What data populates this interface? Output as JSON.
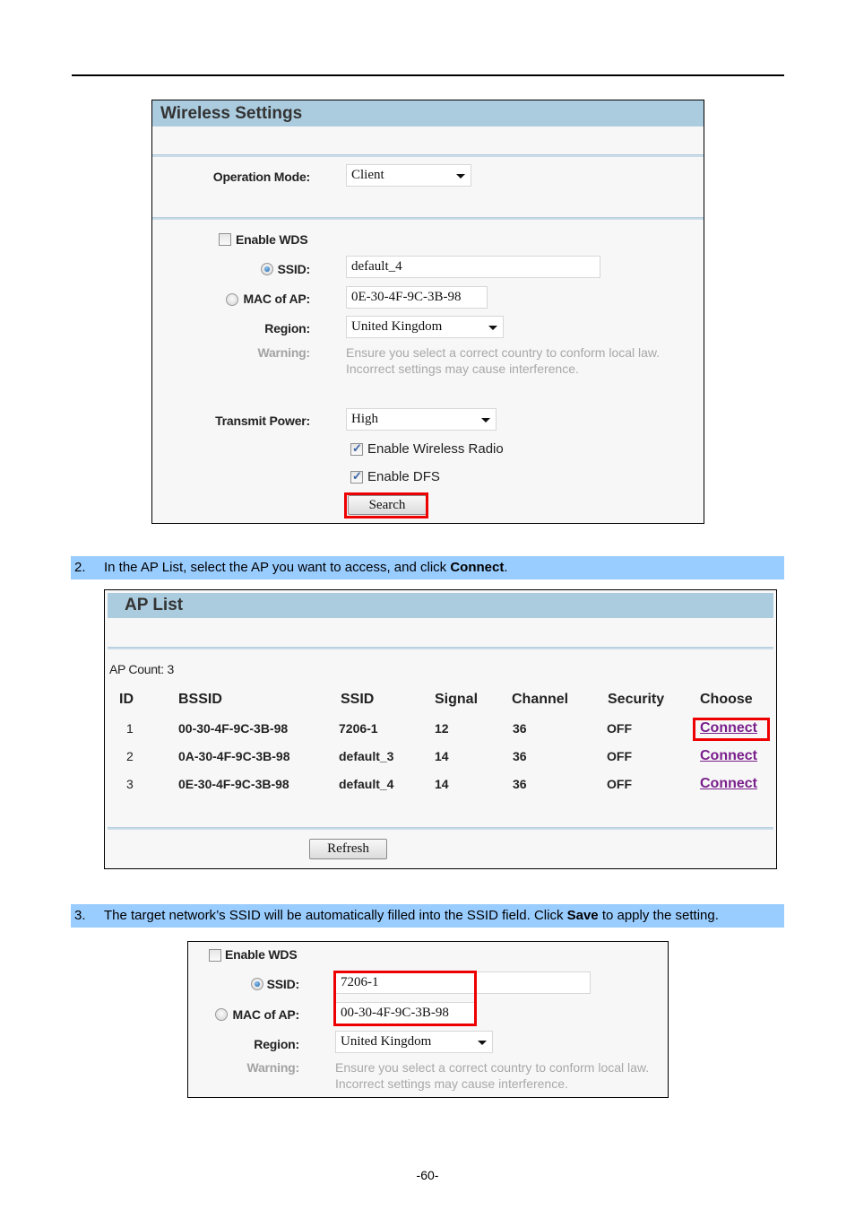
{
  "wireless_settings": {
    "title": "Wireless Settings",
    "operation_mode": {
      "label": "Operation Mode:",
      "value": "Client"
    },
    "enable_wds": {
      "label": "Enable WDS",
      "checked": false
    },
    "ssid": {
      "label": "SSID:",
      "value": "default_4",
      "selected": true
    },
    "mac_of_ap": {
      "label": "MAC of AP:",
      "value": "0E-30-4F-9C-3B-98",
      "selected": false
    },
    "region": {
      "label": "Region:",
      "value": "United Kingdom"
    },
    "warning": {
      "label": "Warning:",
      "line1": "Ensure you select a correct country to conform local law.",
      "line2": "Incorrect settings may cause interference."
    },
    "transmit_power": {
      "label": "Transmit Power:",
      "value": "High"
    },
    "enable_wireless_radio": {
      "label": "Enable Wireless Radio",
      "checked": true
    },
    "enable_dfs": {
      "label": "Enable DFS",
      "checked": true
    },
    "search_button": "Search"
  },
  "steps": [
    {
      "num": "2.",
      "pre": "In the AP List, select the AP you want to access, and click ",
      "bold": "Connect",
      "post": "."
    },
    {
      "num": "3.",
      "pre": "The target network’s SSID will be automatically filled into the SSID field. Click ",
      "bold": "Save",
      "post": " to apply the setting."
    }
  ],
  "ap_list": {
    "title": "AP List",
    "count_text": "AP Count: 3",
    "columns": [
      "ID",
      "BSSID",
      "SSID",
      "Signal",
      "Channel",
      "Security",
      "Choose"
    ],
    "rows": [
      {
        "id": "1",
        "bssid": "00-30-4F-9C-3B-98",
        "ssid": "7206-1",
        "signal": "12",
        "channel": "36",
        "security": "OFF",
        "choose": "Connect"
      },
      {
        "id": "2",
        "bssid": "0A-30-4F-9C-3B-98",
        "ssid": "default_3",
        "signal": "14",
        "channel": "36",
        "security": "OFF",
        "choose": "Connect"
      },
      {
        "id": "3",
        "bssid": "0E-30-4F-9C-3B-98",
        "ssid": "default_4",
        "signal": "14",
        "channel": "36",
        "security": "OFF",
        "choose": "Connect"
      }
    ],
    "refresh_button": "Refresh"
  },
  "result_settings": {
    "enable_wds": {
      "label": "Enable WDS",
      "checked": false
    },
    "ssid": {
      "label": "SSID:",
      "value": "7206-1",
      "selected": true
    },
    "mac_of_ap": {
      "label": "MAC of AP:",
      "value": "00-30-4F-9C-3B-98",
      "selected": false
    },
    "region": {
      "label": "Region:",
      "value": "United Kingdom"
    },
    "warning": {
      "label": "Warning:",
      "line1": "Ensure you select a correct country to conform local law.",
      "line2": "Incorrect settings may cause interference."
    }
  },
  "highlight_color": "#ee0000",
  "page_number": "-60-"
}
